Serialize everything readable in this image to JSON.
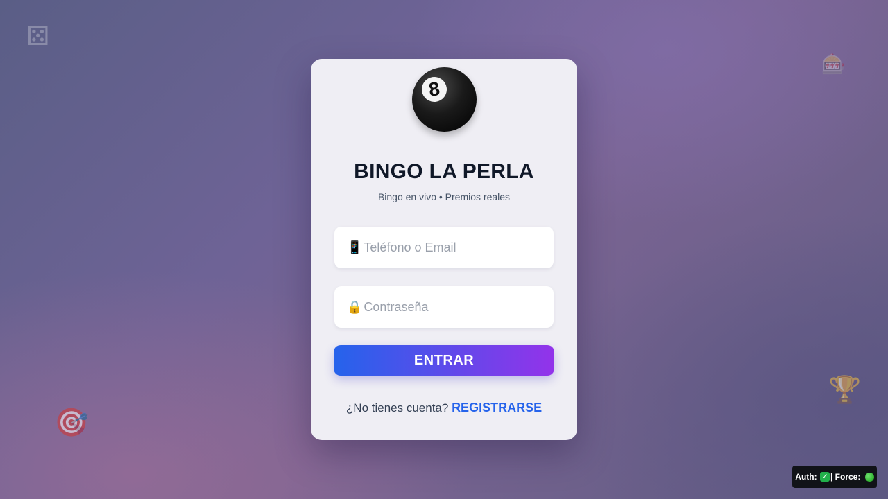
{
  "decorations": {
    "dice": "⚄",
    "slot": "🎰",
    "target": "🎯",
    "trophy": "🏆"
  },
  "card": {
    "logo_number": "8",
    "title": "BINGO LA PERLA",
    "subtitle": "Bingo en vivo • Premios reales"
  },
  "form": {
    "phone_icon": "📱",
    "phone_placeholder": "Teléfono o Email",
    "phone_value": "",
    "password_icon": "🔒",
    "password_placeholder": "Contraseña",
    "password_value": "",
    "submit_label": "ENTRAR"
  },
  "signup": {
    "prompt": "¿No tienes cuenta?",
    "link_label": "REGISTRARSE"
  },
  "status": {
    "auth_label": "Auth:",
    "auth_mark": "✓",
    "force_label": "| Force:"
  },
  "colors": {
    "accent_start": "#2563eb",
    "accent_end": "#9333ea",
    "link": "#2563eb",
    "status_ok": "#22b04b"
  }
}
